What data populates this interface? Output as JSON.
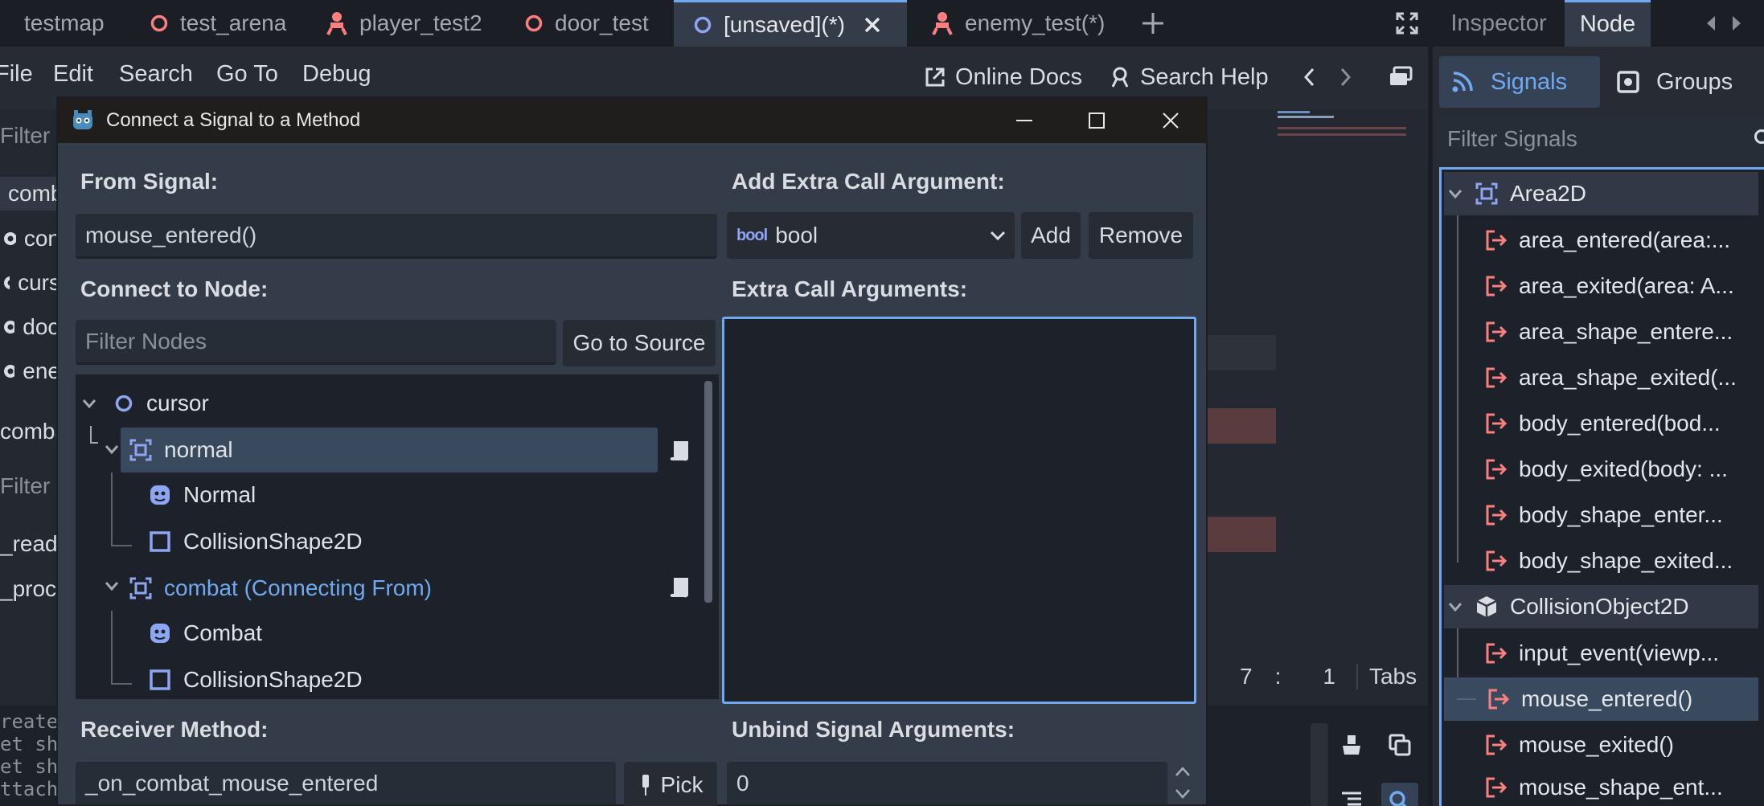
{
  "tabs": [
    {
      "label": "testmap",
      "icon": "circle-icon"
    },
    {
      "label": "test_arena",
      "icon": "circle-icon"
    },
    {
      "label": "player_test2",
      "icon": "character-icon"
    },
    {
      "label": "door_test",
      "icon": "circle-icon"
    },
    {
      "label": "[unsaved](*)",
      "icon": "circle-icon",
      "active": true
    },
    {
      "label": "enemy_test(*)",
      "icon": "character-icon"
    }
  ],
  "menu": [
    "File",
    "Edit",
    "Search",
    "Go To",
    "Debug"
  ],
  "toolbar": {
    "online_docs": "Online Docs",
    "search_help": "Search Help"
  },
  "editor": {
    "filter_scripts": "Filter S",
    "script_items": [
      "comb",
      "con",
      "curs",
      "doo",
      "ene"
    ],
    "script_label": "comba",
    "filter_methods": "Filter M",
    "method_items": [
      "_ready",
      "_proce"
    ],
    "status_line": "7",
    "status_sep": ":",
    "status_col": "1",
    "status_indent": "Tabs",
    "output_lines": [
      "reate",
      "et sh",
      "et sh",
      "ttach"
    ]
  },
  "dock": {
    "tabs": [
      "Inspector",
      "Node"
    ],
    "active_tab": "Node",
    "signals_tab": "Signals",
    "groups_tab": "Groups",
    "filter_placeholder": "Filter Signals",
    "area2d_header": "Area2D",
    "area2d_signals": [
      "area_entered(area:...",
      "area_exited(area: A...",
      "area_shape_entere...",
      "area_shape_exited(...",
      "body_entered(bod...",
      "body_exited(body: ...",
      "body_shape_enter...",
      "body_shape_exited..."
    ],
    "collision_header": "CollisionObject2D",
    "collision_signals": [
      "input_event(viewp...",
      "mouse_entered()",
      "mouse_exited()",
      "mouse_shape_ent..."
    ],
    "selected_signal": "mouse_entered()"
  },
  "dialog": {
    "title": "Connect a Signal to a Method",
    "from_signal_label": "From Signal:",
    "from_signal_value": "mouse_entered()",
    "add_extra_label": "Add Extra Call Argument:",
    "type_icon_text": "bool",
    "type_value": "bool",
    "add_button": "Add",
    "remove_button": "Remove",
    "connect_to_node_label": "Connect to Node:",
    "filter_nodes_placeholder": "Filter Nodes",
    "go_to_source": "Go to Source",
    "extra_args_label": "Extra Call Arguments:",
    "tree": {
      "root": "cursor",
      "normal": "normal",
      "normal_sprite": "Normal",
      "normal_shape": "CollisionShape2D",
      "combat": "combat (Connecting From)",
      "combat_sprite": "Combat",
      "combat_shape": "CollisionShape2D"
    },
    "receiver_label": "Receiver Method:",
    "receiver_value": "_on_combat_mouse_entered",
    "pick_button": "Pick",
    "unbind_label": "Unbind Signal Arguments:",
    "unbind_value": "0"
  },
  "colors": {
    "accent": "#70a9f0",
    "signal_red": "#fc7f7f",
    "node_blue": "#8da5f3",
    "selected_row": "#3a4a5e"
  }
}
